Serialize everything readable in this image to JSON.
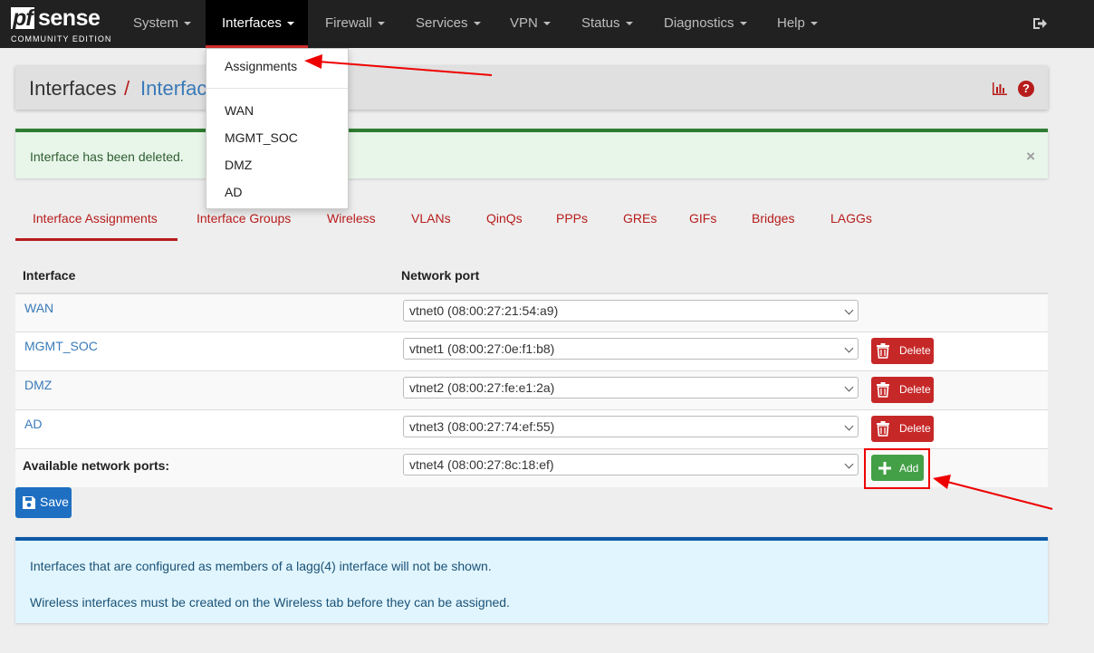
{
  "brand": {
    "logo_pf": "pf",
    "logo_sense": "sense",
    "edition": "COMMUNITY EDITION"
  },
  "nav": {
    "items": [
      "System",
      "Interfaces",
      "Firewall",
      "Services",
      "VPN",
      "Status",
      "Diagnostics",
      "Help"
    ],
    "active": "Interfaces",
    "logout_icon": "sign-out-icon"
  },
  "dropdown": {
    "items": [
      "Assignments",
      "WAN",
      "MGMT_SOC",
      "DMZ",
      "AD"
    ]
  },
  "breadcrumb": {
    "section": "Interfaces",
    "separator": "/",
    "page": "Interface"
  },
  "header_icons": {
    "chart": "bar-chart-icon",
    "help": "?"
  },
  "alert_success": {
    "message": "Interface has been deleted.",
    "close": "×"
  },
  "tabs": [
    "Interface Assignments",
    "Interface Groups",
    "Wireless",
    "VLANs",
    "QinQs",
    "PPPs",
    "GREs",
    "GIFs",
    "Bridges",
    "LAGGs"
  ],
  "active_tab": "Interface Assignments",
  "table": {
    "headers": [
      "Interface",
      "Network port"
    ],
    "rows": [
      {
        "interface": "WAN",
        "port": "vtnet0 (08:00:27:21:54:a9)",
        "action": ""
      },
      {
        "interface": "MGMT_SOC",
        "port": "vtnet1 (08:00:27:0e:f1:b8)",
        "action": "Delete"
      },
      {
        "interface": "DMZ",
        "port": "vtnet2 (08:00:27:fe:e1:2a)",
        "action": "Delete"
      },
      {
        "interface": "AD",
        "port": "vtnet3 (08:00:27:74:ef:55)",
        "action": "Delete"
      }
    ],
    "available": {
      "label": "Available network ports:",
      "port": "vtnet4 (08:00:27:8c:18:ef)",
      "action": "Add"
    }
  },
  "save_label": "Save",
  "alert_info": {
    "line1": "Interfaces that are configured as members of a lagg(4) interface will not be shown.",
    "line2": "Wireless interfaces must be created on the Wireless tab before they can be assigned."
  },
  "colors": {
    "accent_red": "#b71c1c",
    "link_blue": "#3a7ab8",
    "success_green": "#2e7d32",
    "save_blue": "#1e6fc2",
    "annotation_red": "#e00000"
  }
}
